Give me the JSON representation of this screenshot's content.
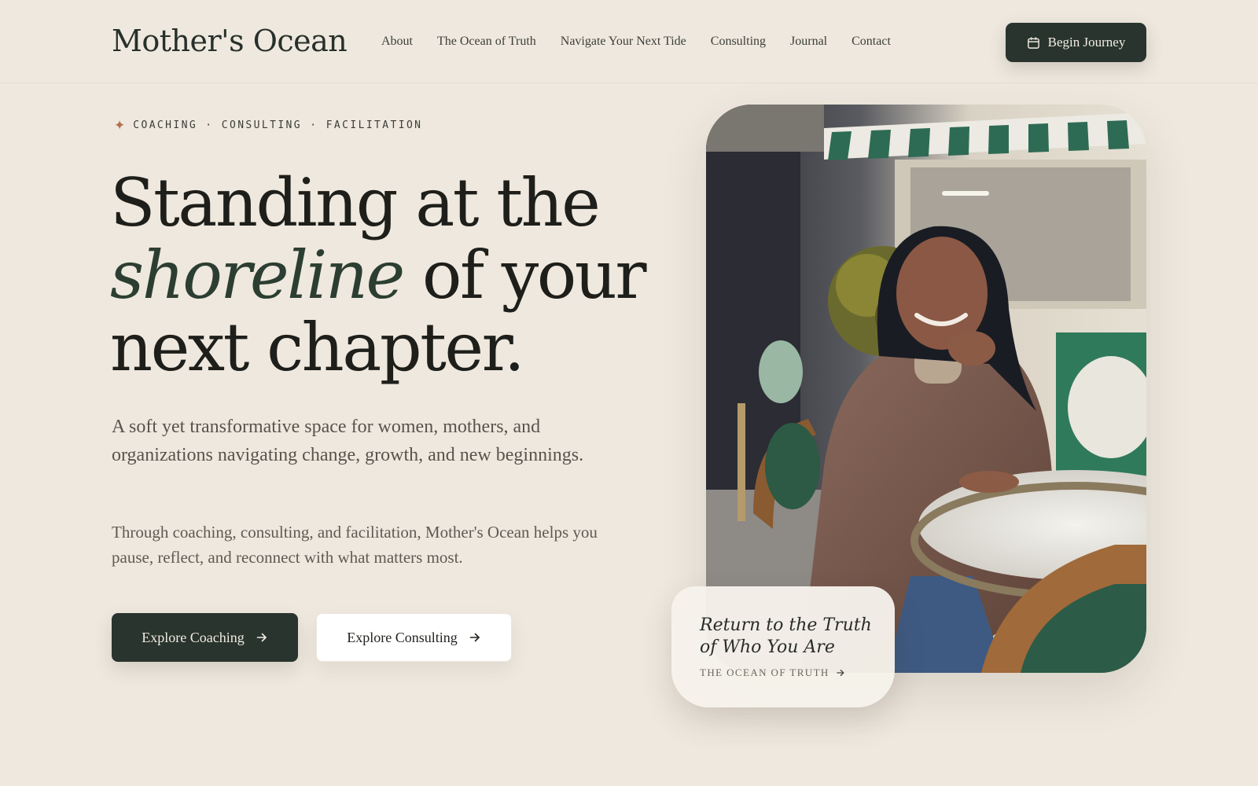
{
  "brand": {
    "name": "Mother's Ocean"
  },
  "nav": {
    "items": [
      {
        "label": "About"
      },
      {
        "label": "The Ocean of Truth"
      },
      {
        "label": "Navigate Your Next Tide"
      },
      {
        "label": "Consulting"
      },
      {
        "label": "Journal"
      },
      {
        "label": "Contact"
      }
    ],
    "cta": {
      "label": "Begin Journey",
      "icon": "calendar-icon"
    }
  },
  "hero": {
    "eyebrow": "COACHING · CONSULTING · FACILITATION",
    "eyebrow_icon": "sparkle-icon",
    "headline": {
      "line1": "Standing at the",
      "line2_italic": "shoreline",
      "line2_rest": " of your",
      "line3": "next chapter."
    },
    "subtitle": "A soft yet transformative space for women, mothers, and organizations navigating change, growth, and new beginnings.",
    "body": "Through coaching, consulting, and facilitation, Mother's Ocean helps you pause, reflect, and reconnect with what matters most.",
    "buttons": {
      "primary": {
        "label": "Explore Coaching",
        "icon": "arrow-right-icon"
      },
      "secondary": {
        "label": "Explore Consulting",
        "icon": "arrow-right-icon"
      }
    },
    "caption": {
      "title": "Return to the Truth of Who You Are",
      "link": "THE OCEAN OF TRUTH",
      "link_icon": "arrow-right-icon"
    }
  },
  "colors": {
    "background": "#efe8de",
    "primary": "#29342e",
    "accent": "#b0714d",
    "italic_green": "#2c3e32"
  }
}
